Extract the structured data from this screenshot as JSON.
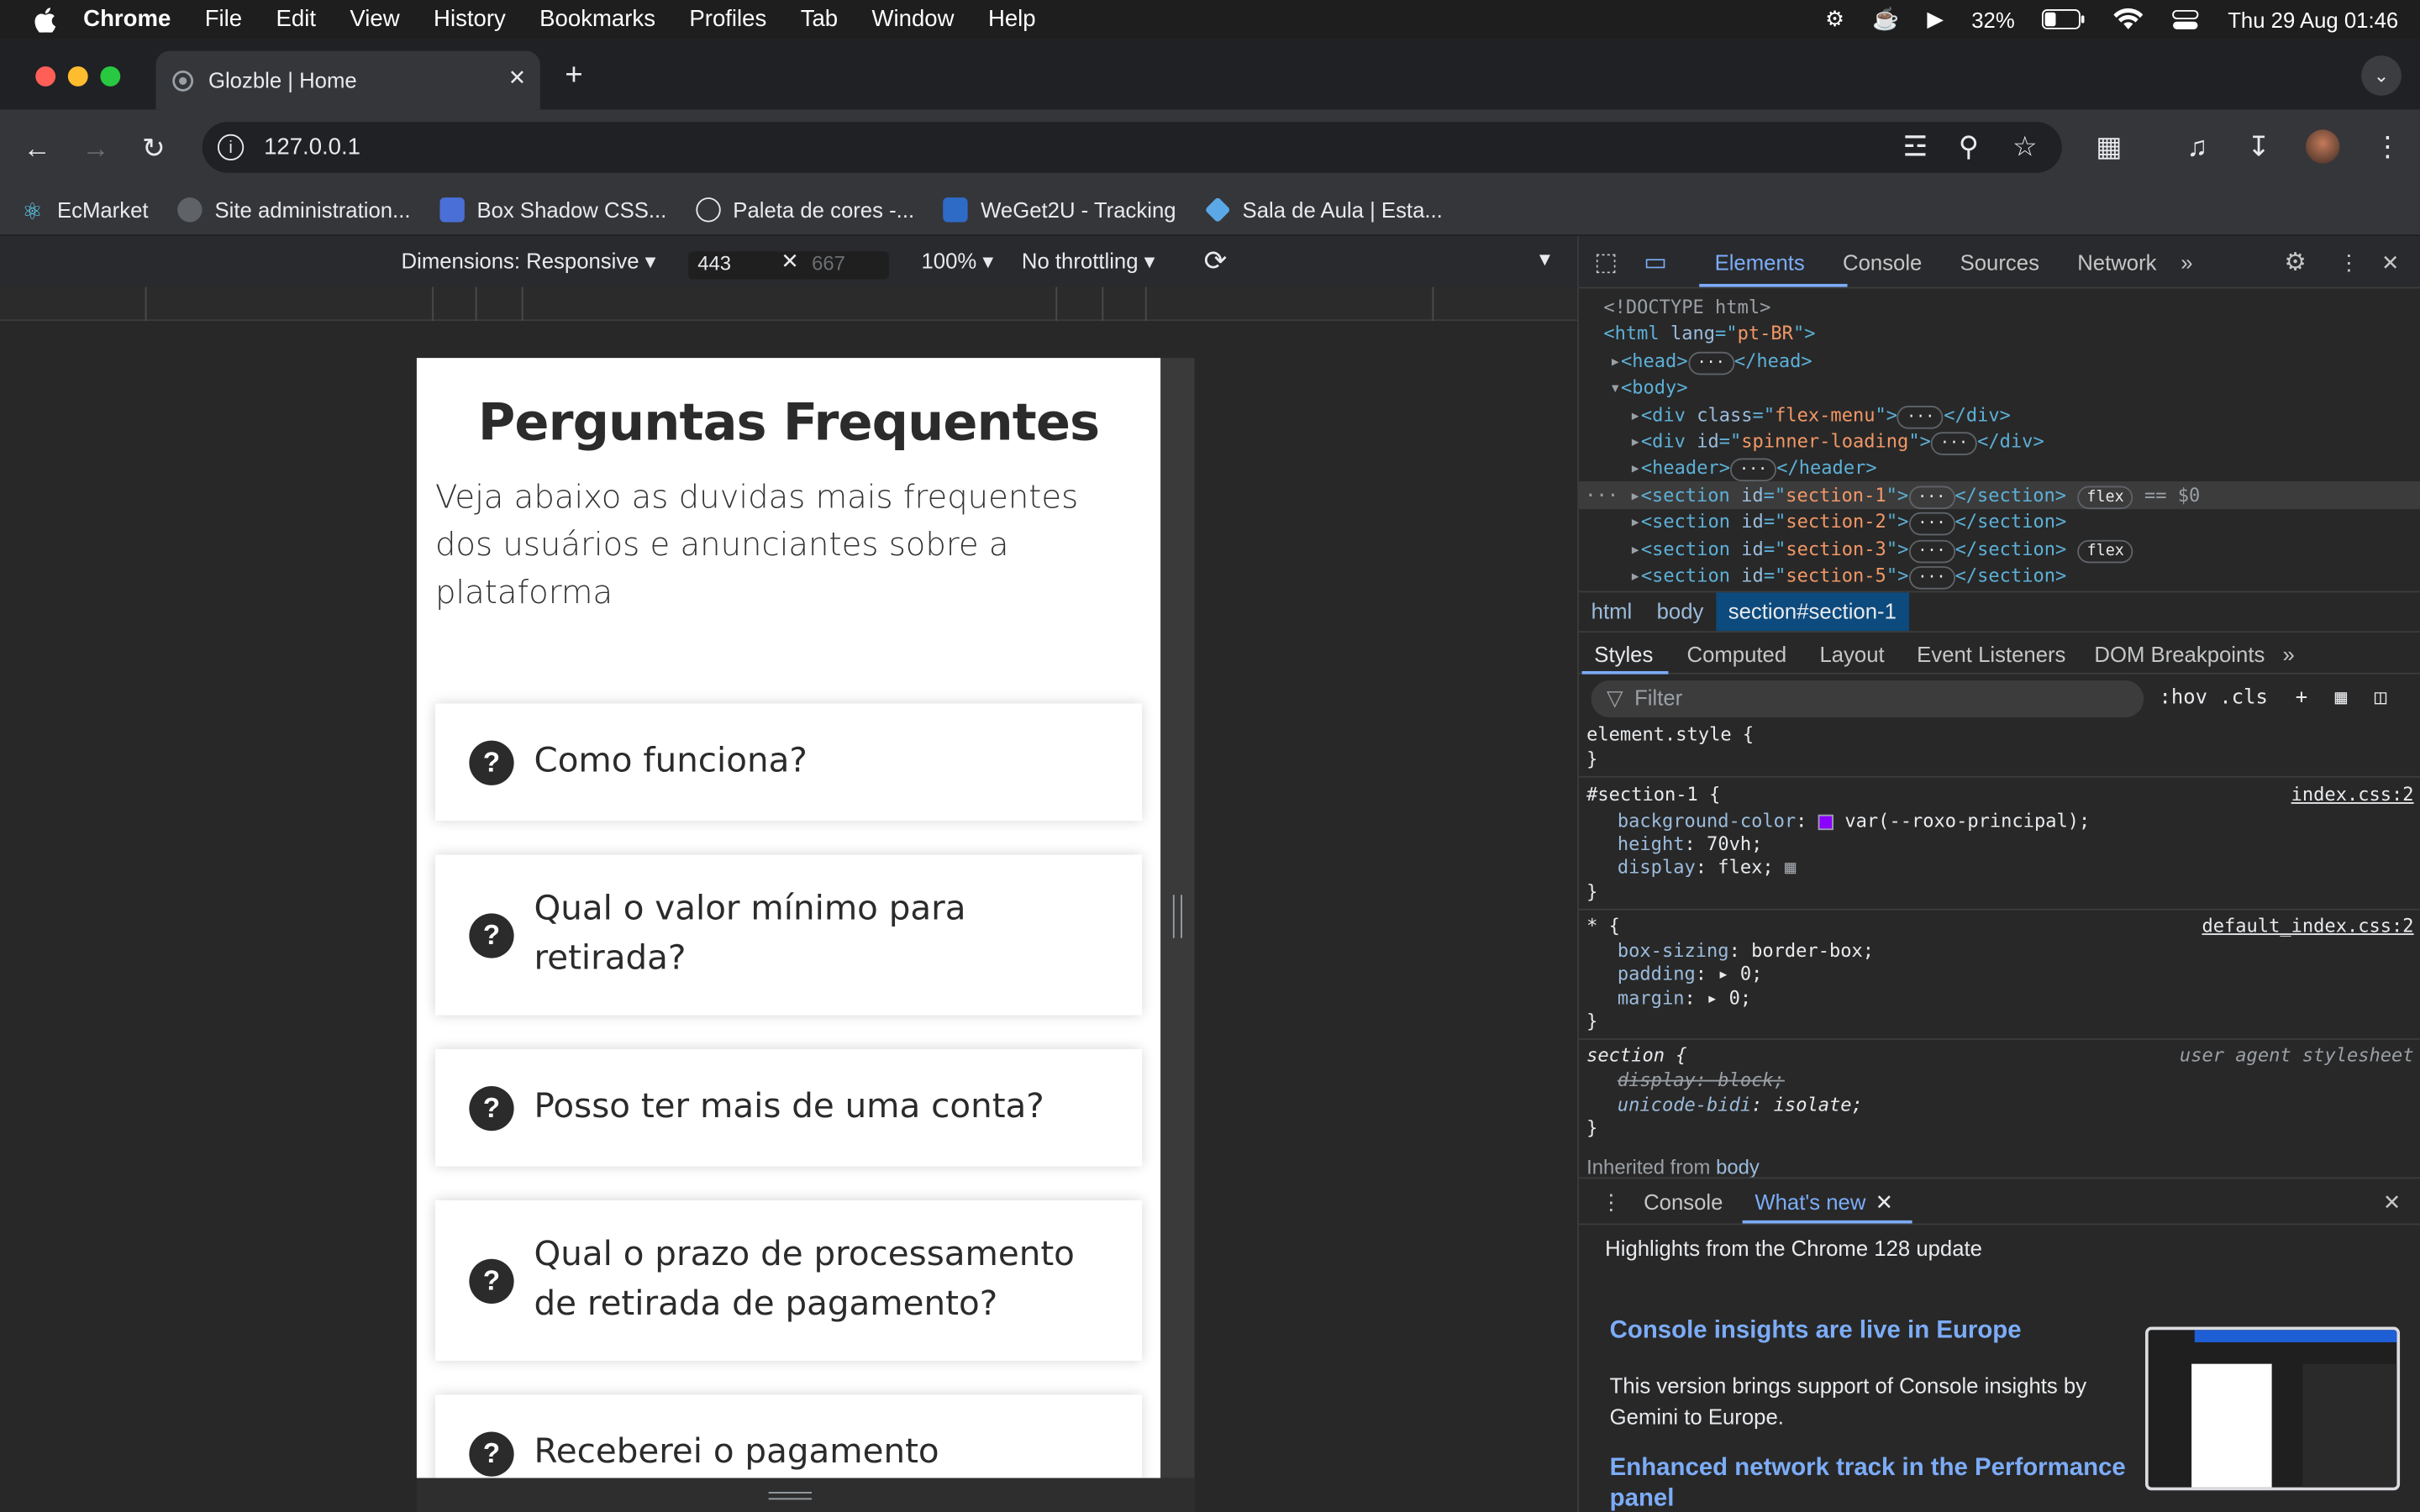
{
  "menubar": {
    "app": "Chrome",
    "items": [
      "File",
      "Edit",
      "View",
      "History",
      "Bookmarks",
      "Profiles",
      "Tab",
      "Window",
      "Help"
    ],
    "battery": "32%",
    "clock": "Thu 29 Aug  01:46"
  },
  "tab": {
    "title": "Glozble | Home"
  },
  "address": {
    "url": "127.0.0.1"
  },
  "bookmarks": [
    {
      "label": "EcMarket"
    },
    {
      "label": "Site administration..."
    },
    {
      "label": "Box Shadow CSS..."
    },
    {
      "label": "Paleta de cores -..."
    },
    {
      "label": "WeGet2U - Tracking"
    },
    {
      "label": "Sala de Aula | Esta..."
    }
  ],
  "device_toolbar": {
    "dimensions": "Dimensions: Responsive",
    "width": "443",
    "height": "667",
    "zoom": "100%",
    "throttling": "No throttling"
  },
  "page": {
    "title": "Perguntas Frequentes",
    "subtitle": "Veja abaixo as duvidas mais frequentes dos usuários e anunciantes sobre a plataforma",
    "questions": [
      "Como funciona?",
      "Qual o valor mínimo para retirada?",
      "Posso ter mais de uma conta?",
      "Qual o prazo de processamento de retirada de pagamento?",
      "Receberei o pagamento"
    ]
  },
  "devtools": {
    "tabs": [
      "Elements",
      "Console",
      "Sources",
      "Network"
    ],
    "dom": {
      "doctype": "<!DOCTYPE html>",
      "html_lang": "pt-BR",
      "flex_menu": "flex-menu",
      "spinner": "spinner-loading",
      "s1": "section-1",
      "s2": "section-2",
      "s3": "section-3",
      "s5": "section-5",
      "pill": "flex",
      "selected_marker": "== $0"
    },
    "breadcrumbs": [
      "html",
      "body",
      "section#section-1"
    ],
    "style_tabs": [
      "Styles",
      "Computed",
      "Layout",
      "Event Listeners",
      "DOM Breakpoints"
    ],
    "filter_placeholder": "Filter",
    "filter_tools": ":hov  .cls",
    "rules": {
      "element_style": "element.style {",
      "section1_selector": "#section-1 {",
      "section1_src": "index.css:2",
      "bg_prop": "background-color",
      "bg_val": "var(--roxo-principal);",
      "height_prop": "height",
      "height_val": "70vh;",
      "display_prop": "display",
      "display_val": "flex;",
      "star_selector": "* {",
      "star_src": "default_index.css:2",
      "boxsizing_prop": "box-sizing",
      "boxsizing_val": "border-box;",
      "padding_prop": "padding",
      "padding_val": "0;",
      "margin_prop": "margin",
      "margin_val": "0;",
      "section_selector": "section {",
      "ua_label": "user agent stylesheet",
      "ua_display": "display: block;",
      "unicode_prop": "unicode-bidi",
      "unicode_val": "isolate;",
      "close_brace": "}",
      "swatch_color": "#8b00ff"
    },
    "inherited": "Inherited from",
    "inherited_from": "body",
    "drawer": {
      "tabs": [
        "Console",
        "What's new"
      ],
      "highlights": "Highlights from the Chrome 128 update",
      "h1": "Console insights are live in Europe",
      "p1": "This version brings support of Console insights by Gemini to Europe.",
      "h2": "Enhanced network track in the Performance panel"
    }
  }
}
